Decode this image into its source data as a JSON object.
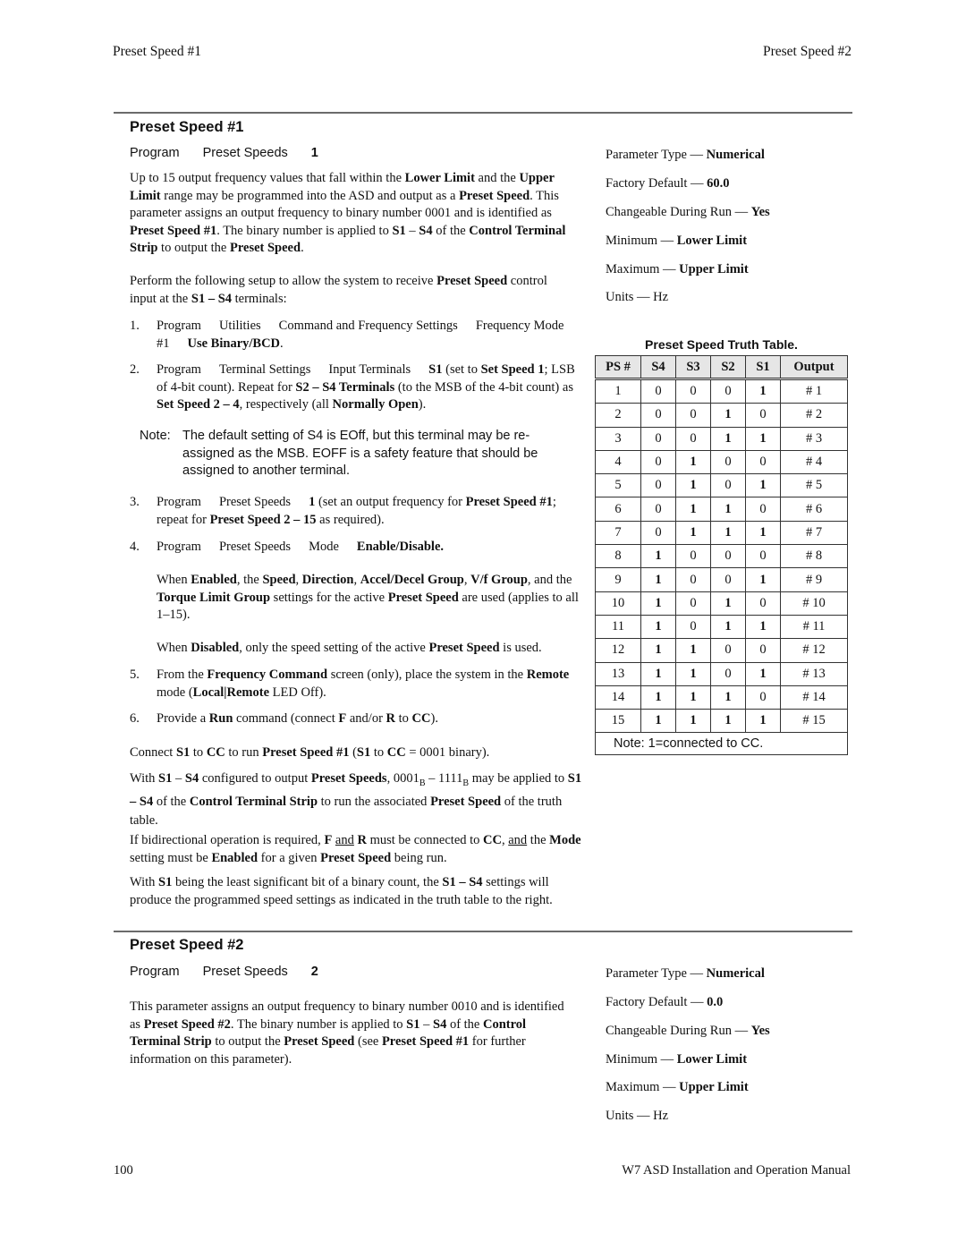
{
  "header": {
    "left": "Preset Speed #1",
    "right": "Preset Speed #2"
  },
  "footer": {
    "page_number": "100",
    "manual_title": "W7 ASD Installation and Operation Manual"
  },
  "section1": {
    "title": "Preset Speed #1",
    "path": [
      "Program",
      "Preset Speeds",
      "1"
    ],
    "intro": {
      "t1": "Up to 15 output frequency values that fall within the ",
      "b1": "Lower Limit",
      "t2": " and the ",
      "b2": "Upper Limit",
      "t3": " range may be programmed into the ASD and output as a ",
      "b3": "Preset Speed",
      "t4": ". This parameter assigns an output frequency to binary number 0001 and is identified as ",
      "b4": "Preset Speed #1",
      "t5": ". The binary number is applied to ",
      "b5": "S1",
      "t6": " – ",
      "b6": "S4",
      "t7": " of the ",
      "b7": "Control Terminal Strip",
      "t8": " to output the ",
      "b8": "Preset Speed",
      "t9": "."
    },
    "setup": {
      "t1": "Perform the following setup to allow the system to receive ",
      "b1": "Preset Speed",
      "t2": " control input at the ",
      "b2": "S1 – S4",
      "t3": " terminals:"
    },
    "steps": [
      {
        "num": "1.",
        "path": [
          "Program",
          "Utilities",
          "Command and Frequency Settings",
          "Frequency Mode #1"
        ],
        "bold": "Use Binary/BCD",
        "tail": "."
      },
      {
        "num": "2.",
        "path": [
          "Program",
          "Terminal Settings",
          "Input Terminals"
        ],
        "b1": "S1",
        "t1": " (set to ",
        "b2": "Set Speed 1",
        "t2": "; LSB of 4-bit count). Repeat for ",
        "b3": "S2 – S4 Terminals",
        "t3": " (to the MSB of the 4-bit count) as ",
        "b4": "Set Speed 2 – 4",
        "t4": ", respectively (all ",
        "b5": "Normally Open",
        "t5": ")."
      },
      {
        "num": "3.",
        "path": [
          "Program",
          "Preset Speeds"
        ],
        "b1": "1",
        "t1": " (set an output frequency for ",
        "b2": "Preset Speed #1",
        "t2": "; repeat for ",
        "b3": "Preset Speed 2 – 15",
        "t3": " as required)."
      },
      {
        "num": "4.",
        "path": [
          "Program",
          "Preset Speeds",
          "Mode"
        ],
        "bold": "Enable/Disable."
      },
      {
        "num": "5.",
        "t1": "From the ",
        "b1": "Frequency Command",
        "t2": " screen (only), place the system in the ",
        "b2": "Remote",
        "t3": " mode (",
        "b3": "Local|Remote",
        "t4": " LED Off)."
      },
      {
        "num": "6.",
        "t1": "Provide a ",
        "b1": "Run",
        "t2": " command (connect ",
        "b2": "F",
        "t3": " and/or ",
        "b3": "R",
        "t4": " to ",
        "b4": "CC",
        "t5": ")."
      }
    ],
    "note": {
      "label": "Note:",
      "text": "The default setting of S4 is EOff, but this terminal may be re-assigned as the MSB. EOFF is a safety feature that should be assigned to another terminal."
    },
    "enabled": {
      "t1": "When ",
      "b1": "Enabled",
      "t2": ", the ",
      "b2": "Speed",
      "t3": ", ",
      "b3": "Direction",
      "t4": ", ",
      "b4": "Accel/Decel Group",
      "t5": ", ",
      "b5": "V/f Group",
      "t6": ", and the ",
      "b6": "Torque Limit Group",
      "t7": " settings for the active ",
      "b7": "Preset Speed",
      "t8": " are used (applies to all 1–15)."
    },
    "disabled": {
      "t1": "When ",
      "b1": "Disabled",
      "t2": ", only the speed setting of the active ",
      "b2": "Preset Speed",
      "t3": " is used."
    },
    "connect": {
      "t1": "Connect ",
      "b1": "S1",
      "t2": " to ",
      "b2": "CC",
      "t3": " to run ",
      "b3": "Preset Speed #1",
      "t4": " (",
      "b4": "S1",
      "t5": " to ",
      "b5": "CC",
      "t6": " = 0001 binary)."
    },
    "configured": {
      "t1": "With ",
      "b1": "S1",
      "t2": " – ",
      "b2": "S4",
      "t3": " configured to output ",
      "b3": "Preset Speeds",
      "t4": ", 0001",
      "s1": "B",
      "t5": " – 1111",
      "s2": "B",
      "t6": " may be applied to ",
      "b4": "S1 – S4",
      "t7": " of the ",
      "b5": "Control Terminal Strip",
      "t8": " to run the associated ",
      "b6": "Preset Speed",
      "t9": " of the truth table."
    },
    "bidirectional": {
      "t1": "If bidirectional operation is required, ",
      "b1": "F",
      "u1": "and",
      "b2": "R",
      "t2": " must be connected to ",
      "b3": "CC",
      "t3": ", ",
      "u2": "and",
      "t4": " the ",
      "b4": "Mode",
      "t5": " setting must be ",
      "b5": "Enabled",
      "t6": " for a given ",
      "b6": "Preset Speed",
      "t7": " being run."
    },
    "lsb": {
      "t1": "With ",
      "b1": "S1",
      "t2": " being the least significant bit of a binary count, the ",
      "b2": "S1 – S4",
      "t3": " settings will produce the programmed speed settings as indicated in the truth table to the right."
    },
    "properties": {
      "type_label": "Parameter Type — ",
      "type_value": "Numerical",
      "default_label": "Factory Default — ",
      "default_value": "60.0",
      "changeable_label": "Changeable During Run — ",
      "changeable_value": "Yes",
      "min_label": "Minimum — ",
      "min_value": "Lower Limit",
      "max_label": "Maximum — ",
      "max_value": "Upper Limit",
      "units": "Units — Hz"
    }
  },
  "truth_table": {
    "title": "Preset Speed Truth Table.",
    "headers": [
      "PS #",
      "S4",
      "S3",
      "S2",
      "S1",
      "Output"
    ],
    "rows": [
      [
        "1",
        "0",
        "0",
        "0",
        "1",
        "# 1"
      ],
      [
        "2",
        "0",
        "0",
        "1",
        "0",
        "# 2"
      ],
      [
        "3",
        "0",
        "0",
        "1",
        "1",
        "# 3"
      ],
      [
        "4",
        "0",
        "1",
        "0",
        "0",
        "# 4"
      ],
      [
        "5",
        "0",
        "1",
        "0",
        "1",
        "# 5"
      ],
      [
        "6",
        "0",
        "1",
        "1",
        "0",
        "# 6"
      ],
      [
        "7",
        "0",
        "1",
        "1",
        "1",
        "# 7"
      ],
      [
        "8",
        "1",
        "0",
        "0",
        "0",
        "# 8"
      ],
      [
        "9",
        "1",
        "0",
        "0",
        "1",
        "# 9"
      ],
      [
        "10",
        "1",
        "0",
        "1",
        "0",
        "# 10"
      ],
      [
        "11",
        "1",
        "0",
        "1",
        "1",
        "# 11"
      ],
      [
        "12",
        "1",
        "1",
        "0",
        "0",
        "# 12"
      ],
      [
        "13",
        "1",
        "1",
        "0",
        "1",
        "# 13"
      ],
      [
        "14",
        "1",
        "1",
        "1",
        "0",
        "# 14"
      ],
      [
        "15",
        "1",
        "1",
        "1",
        "1",
        "# 15"
      ]
    ],
    "note": "Note:  1=connected to CC."
  },
  "section2": {
    "title": "Preset Speed #2",
    "path": [
      "Program",
      "Preset Speeds",
      "2"
    ],
    "intro": {
      "t1": "This parameter assigns an output frequency to binary number 0010 and is identified as ",
      "b1": "Preset Speed #2",
      "t2": ". The binary number is applied to ",
      "b2": "S1",
      "t3": " – ",
      "b3": "S4",
      "t4": " of the ",
      "b4": "Control Terminal Strip",
      "t5": " to output the ",
      "b5": "Preset Speed",
      "t6": " (see ",
      "b6": "Preset Speed #1",
      "t7": " for further information on this parameter)."
    },
    "properties": {
      "type_label": "Parameter Type — ",
      "type_value": "Numerical",
      "default_label": "Factory Default — ",
      "default_value": "0.0",
      "changeable_label": "Changeable During Run — ",
      "changeable_value": "Yes",
      "min_label": "Minimum — ",
      "min_value": "Lower Limit",
      "max_label": "Maximum — ",
      "max_value": "Upper Limit",
      "units": "Units — Hz"
    }
  }
}
